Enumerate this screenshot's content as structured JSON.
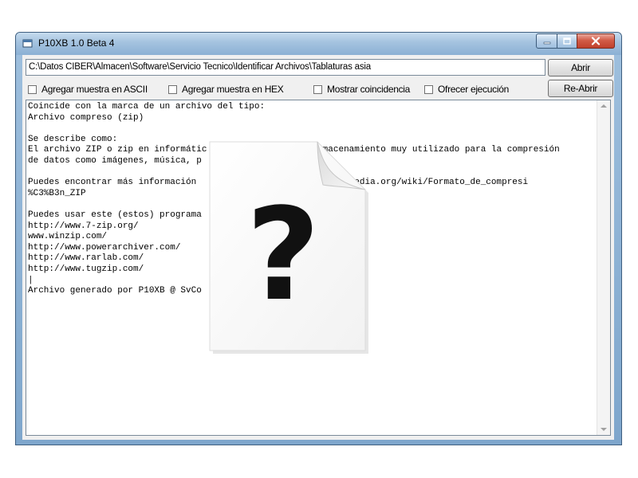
{
  "window": {
    "title": "P10XB 1.0 Beta 4",
    "controls": {
      "minimize": "minimize",
      "maximize": "maximize",
      "close": "close"
    }
  },
  "toolbar": {
    "path_value": "C:\\Datos CIBER\\Almacen\\Software\\Servicio Tecnico\\Identificar Archivos\\Tablaturas asia",
    "open_label": "Abrir",
    "reopen_label": "Re-Abrir"
  },
  "options": [
    {
      "label": "Agregar muestra en ASCII",
      "checked": false
    },
    {
      "label": "Agregar muestra en HEX",
      "checked": false
    },
    {
      "label": "Mostrar coincidencia",
      "checked": false
    },
    {
      "label": "Ofrecer ejecución",
      "checked": false
    }
  ],
  "output": {
    "text": "Coincide con la marca de un archivo del tipo:\nArchivo compreso (zip)\n\nSe describe como:\nEl archivo ZIP o zip en informátic                    almacenamiento muy utilizado para la compresión\nde datos como imágenes, música, p\n\nPuedes encontrar más información                      es.wikipedia.org/wiki/Formato_de_compresi\n%C3%B3n_ZIP\n\nPuedes usar este (estos) programa                     archivo:\nhttp://www.7-zip.org/\nwww.winzip.com/\nhttp://www.powerarchiver.com/\nhttp://www.rarlab.com/\nhttp://www.tugzip.com/\n|\nArchivo generado por P10XB @ SvCo"
  },
  "overlay": {
    "icon": "unknown-file-icon",
    "symbol": "?"
  },
  "colors": {
    "titlebar": "#a6c4e0",
    "close_button": "#c0402b",
    "client_bg": "#f0f0f0"
  }
}
